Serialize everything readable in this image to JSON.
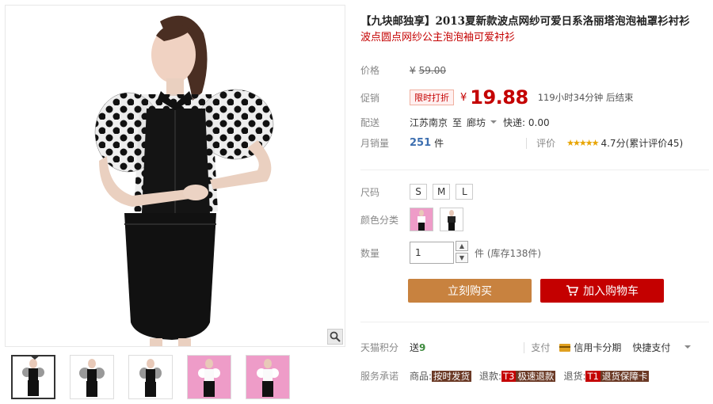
{
  "product": {
    "title": "【九块邮独享】2013夏新款波点网纱可爱日系洛丽塔泡泡袖罩衫衬衫",
    "subtitle": "波点圆点网纱公主泡泡袖可爱衬衫"
  },
  "price": {
    "label": "价格",
    "currency": "¥",
    "original": "59.00"
  },
  "promo": {
    "label": "促销",
    "tag": "限时打折",
    "currency": "¥",
    "price": "19.88",
    "countdown": "119小时34分钟 后结束"
  },
  "shipping": {
    "label": "配送",
    "from": "江苏南京",
    "to_word": "至",
    "destination": "廊坊",
    "method": "快递: 0.00"
  },
  "sales": {
    "label": "月销量",
    "count": "251",
    "unit": "件",
    "review_label": "评价",
    "stars": "★★★★★",
    "rating_text": "4.7分(累计评价45)"
  },
  "sizes": {
    "label": "尺码",
    "options": [
      "S",
      "M",
      "L"
    ]
  },
  "colors": {
    "label": "颜色分类"
  },
  "quantity": {
    "label": "数量",
    "value": "1",
    "unit_stock": "件 (库存138件)"
  },
  "buttons": {
    "buy_now": "立刻购买",
    "add_cart": "加入购物车"
  },
  "points": {
    "label": "天猫积分",
    "send_prefix": "送",
    "send_value": "9",
    "pay_label": "支付",
    "credit_card": "信用卡分期",
    "quick_pay": "快捷支付"
  },
  "service": {
    "label": "服务承诺",
    "item1_prefix": "商品:",
    "item1_tag": "按时发货",
    "item2_prefix": "退款:",
    "item2_tag_code": "T3",
    "item2_tag": "极速退款",
    "item3_prefix": "退货:",
    "item3_tag_code": "T1",
    "item3_tag": "退货保障卡"
  },
  "colors_theme": {
    "accent_red": "#c40000",
    "buy_button": "#c8823f",
    "sales_blue": "#3d6fb0"
  },
  "icons": [
    "zoom-icon",
    "cart-icon",
    "chevron-down-icon",
    "credit-card-icon"
  ]
}
